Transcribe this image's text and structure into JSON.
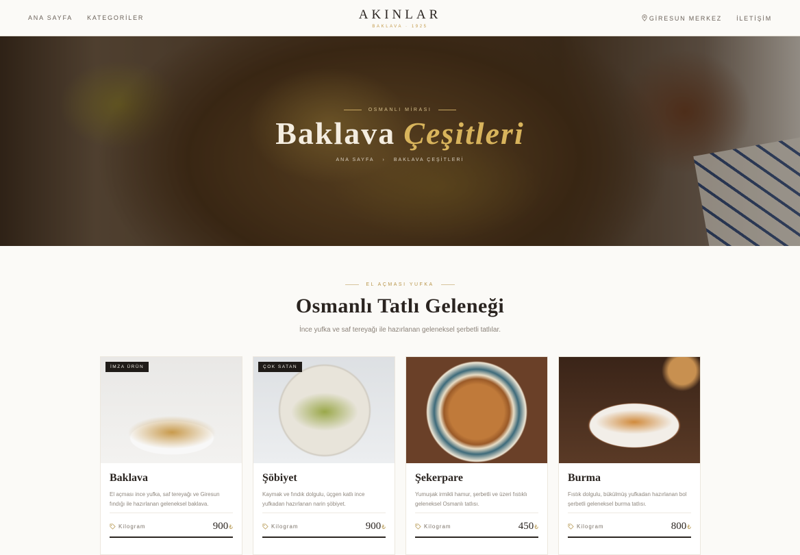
{
  "header": {
    "nav_left": [
      "ANA SAYFA",
      "KATEGORİLER"
    ],
    "logo_name": "AKINLAR",
    "logo_sub": "BAKLAVA · 1925",
    "location_label": "GİRESUN MERKEZ",
    "contact_label": "İLETİŞİM"
  },
  "hero": {
    "eyebrow": "OSMANLI MİRASI",
    "title_main": "Baklava",
    "title_accent": "Çeşitleri",
    "breadcrumb": [
      "ANA SAYFA",
      "›",
      "BAKLAVA ÇEŞİTLERİ"
    ]
  },
  "section": {
    "eyebrow": "EL AÇMASI YUFKA",
    "title": "Osmanlı Tatlı Geleneği",
    "subtitle": "İnce yufka ve saf tereyağı ile hazırlanan geleneksel şerbetli tatlılar."
  },
  "products": [
    {
      "badge": "İMZA ÜRÜN",
      "name": "Baklava",
      "desc": "El açması ince yufka, saf tereyağı ve Giresun fındığı ile hazırlanan geleneksel baklava.",
      "unit": "Kilogram",
      "price": "900",
      "currency": "₺"
    },
    {
      "badge": "ÇOK SATAN",
      "name": "Şöbiyet",
      "desc": "Kaymak ve fındık dolgulu, üçgen katlı ince yufkadan hazırlanan narin şöbiyet.",
      "unit": "Kilogram",
      "price": "900",
      "currency": "₺"
    },
    {
      "badge": "",
      "name": "Şekerpare",
      "desc": "Yumuşak irmikli hamur, şerbetli ve üzeri fıstıklı geleneksel Osmanlı tatlısı.",
      "unit": "Kilogram",
      "price": "450",
      "currency": "₺"
    },
    {
      "badge": "",
      "name": "Burma",
      "desc": "Fıstık dolgulu, bükülmüş yufkadan hazırlanan bol şerbetli geleneksel burma tatlısı.",
      "unit": "Kilogram",
      "price": "800",
      "currency": "₺"
    }
  ],
  "icons": {
    "location": "map-pin-icon",
    "tag": "tag-icon"
  },
  "colors": {
    "accent": "#c29a4a",
    "dark": "#2a2420",
    "background": "#fbfaf7"
  }
}
